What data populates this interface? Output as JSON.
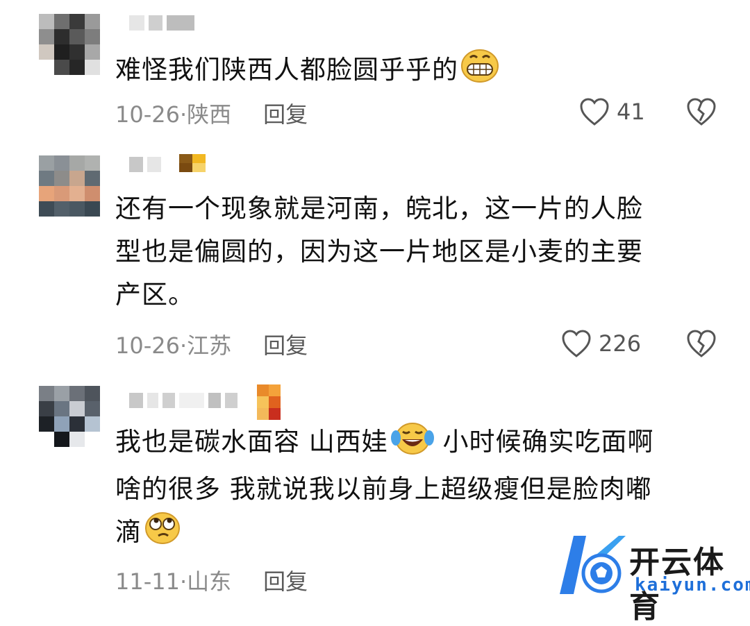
{
  "comments": [
    {
      "text": "难怪我们陕西人都脸圆乎乎的",
      "emoji": "grinning-face",
      "date_location": "10-26·陕西",
      "reply": "回复",
      "likes": "41"
    },
    {
      "text_lines": [
        "还有一个现象就是河南，皖北，这一片的人脸",
        "型也是偏圆的，因为这一片地区是小麦的主要",
        "产区。"
      ],
      "date_location": "10-26·江苏",
      "reply": "回复",
      "likes": "226"
    },
    {
      "text_line1": "我也是碳水面容 山西娃",
      "emoji1": "crying-laughing-face",
      "text_line1b": " 小时候确实吃面啊",
      "text_line2": "啥的很多 我就说我以前身上超级瘦但是脸肉嘟",
      "text_line3": "滴",
      "emoji2": "rolling-eyes-face",
      "date_location": "11-11·山东",
      "reply": "回复"
    }
  ],
  "watermark": {
    "title": "开云体育",
    "domain": "kaiyun.com"
  },
  "colors": {
    "meta": "#8a8a8a",
    "watermark_blue": "#1e6fd9"
  }
}
